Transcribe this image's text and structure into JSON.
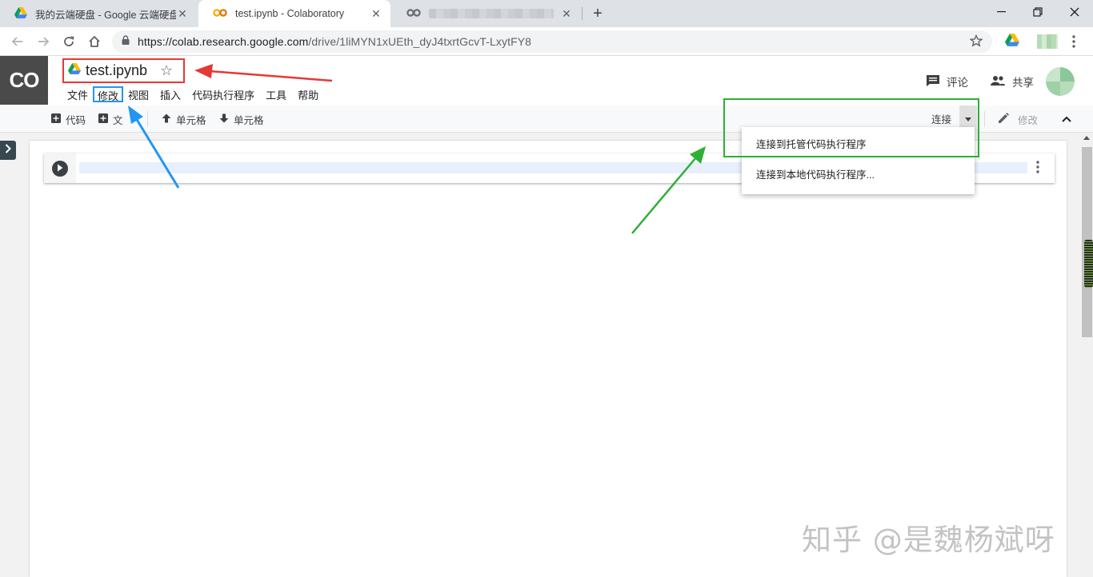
{
  "browser": {
    "tabs": [
      {
        "title": "我的云端硬盘 - Google 云端硬盘",
        "icon": "google-drive-icon",
        "active": false
      },
      {
        "title": "test.ipynb - Colaboratory",
        "icon": "colab-icon",
        "active": true
      },
      {
        "title": "",
        "icon": "colab-icon",
        "active": false,
        "obscured": true
      }
    ],
    "url_host": "https://colab.research.google.com",
    "url_path": "/drive/1liMYN1xUEth_dyJ4txrtGcvT-LxytFY8"
  },
  "colab": {
    "logo_text": "CO",
    "doc_title": "test.ipynb",
    "menu": [
      "文件",
      "修改",
      "视图",
      "插入",
      "代码执行程序",
      "工具",
      "帮助"
    ],
    "comment_label": "评论",
    "share_label": "共享",
    "toolbar": {
      "add_code": "代码",
      "add_text": "文",
      "move_up": "单元格",
      "move_down": "单元格",
      "connect": "连接",
      "edit": "修改"
    },
    "connect_menu": [
      "连接到托管代码执行程序",
      "连接到本地代码执行程序..."
    ]
  },
  "watermark": "知乎 @是魏杨斌呀",
  "colors": {
    "annotation_red": "#e53935",
    "annotation_blue": "#2196f3",
    "annotation_green": "#2db035",
    "colab_orange": "#f9ab00"
  }
}
